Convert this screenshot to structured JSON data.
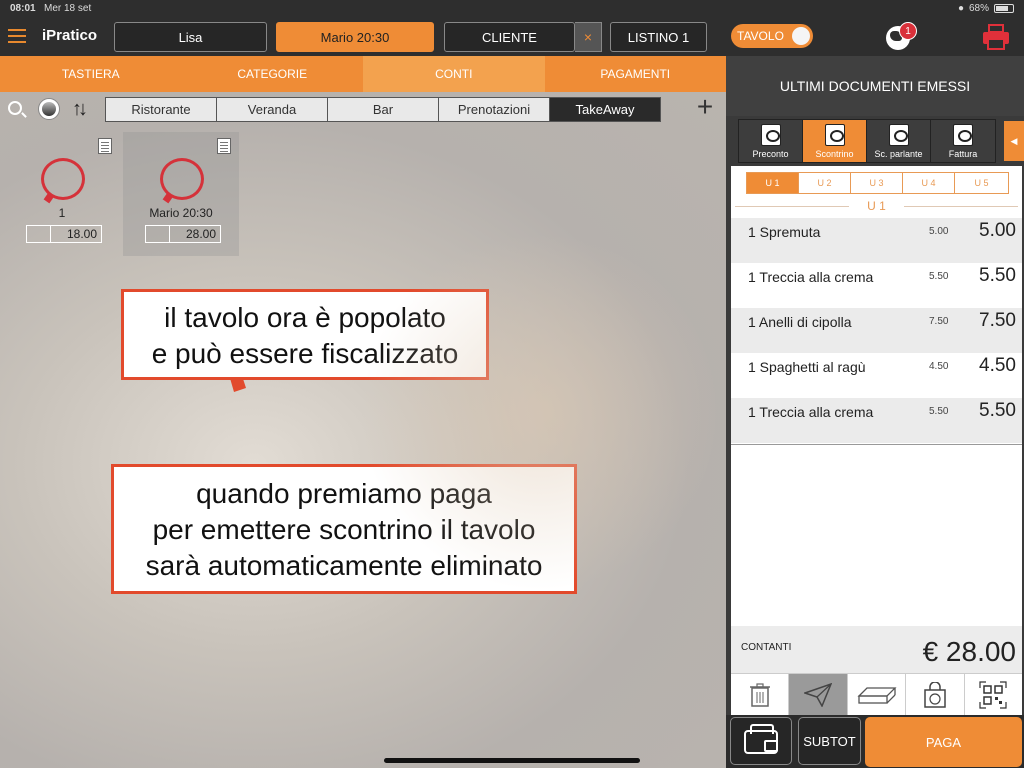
{
  "status_bar": {
    "time": "08:01",
    "date": "Mer 18 set",
    "battery": "68%"
  },
  "header": {
    "app_name": "iPratico",
    "operator": "Lisa",
    "table": "Mario 20:30",
    "cliente_label": "CLIENTE",
    "clear_symbol": "×",
    "listino": "LISTINO 1",
    "toggle_label": "TAVOLO",
    "notifications_count": "1"
  },
  "tabs": [
    {
      "label": "TASTIERA",
      "selected": false
    },
    {
      "label": "CATEGORIE",
      "selected": false
    },
    {
      "label": "CONTI",
      "selected": true
    },
    {
      "label": "PAGAMENTI",
      "selected": false
    }
  ],
  "rooms": {
    "items": [
      "Ristorante",
      "Veranda",
      "Bar",
      "Prenotazioni",
      "TakeAway"
    ],
    "selected": "TakeAway",
    "sort_symbol": "↑↓",
    "add_symbol": "+"
  },
  "tables": [
    {
      "name": "1",
      "amount": "18.00"
    },
    {
      "name": "Mario 20:30",
      "amount": "28.00"
    }
  ],
  "callouts": {
    "first": [
      "il tavolo ora è popolato",
      "e può essere fiscalizzato"
    ],
    "second": [
      "quando premiamo paga",
      "per emettere scontrino il tavolo",
      "sarà automaticamente eliminato"
    ]
  },
  "right_panel": {
    "title": "ULTIMI DOCUMENTI EMESSI",
    "doc_types": [
      {
        "label": "Preconto",
        "selected": false
      },
      {
        "label": "Scontrino",
        "selected": true
      },
      {
        "label": "Sc. parlante",
        "selected": false
      },
      {
        "label": "Fattura",
        "selected": false
      }
    ],
    "users": [
      "U 1",
      "U 2",
      "U 3",
      "U 4",
      "U 5"
    ],
    "selected_user": "U 1",
    "section_label": "U 1",
    "items": [
      {
        "name": "1 Spremuta",
        "unit": "5.00",
        "total": "5.00"
      },
      {
        "name": "1 Treccia alla crema",
        "unit": "5.50",
        "total": "5.50"
      },
      {
        "name": "1 Anelli di cipolla",
        "unit": "7.50",
        "total": "7.50"
      },
      {
        "name": "1 Spaghetti al ragù",
        "unit": "4.50",
        "total": "4.50"
      },
      {
        "name": "1 Treccia alla crema",
        "unit": "5.50",
        "total": "5.50"
      }
    ],
    "payment_method": "CONTANTI",
    "total": "€ 28.00",
    "subtot_label": "SUBTOT",
    "paga_label": "PAGA"
  },
  "colors": {
    "accent": "#ef8c36",
    "dark": "#2e2e2e",
    "callout_border": "#e24a2c",
    "table_icon": "#d5323a"
  }
}
